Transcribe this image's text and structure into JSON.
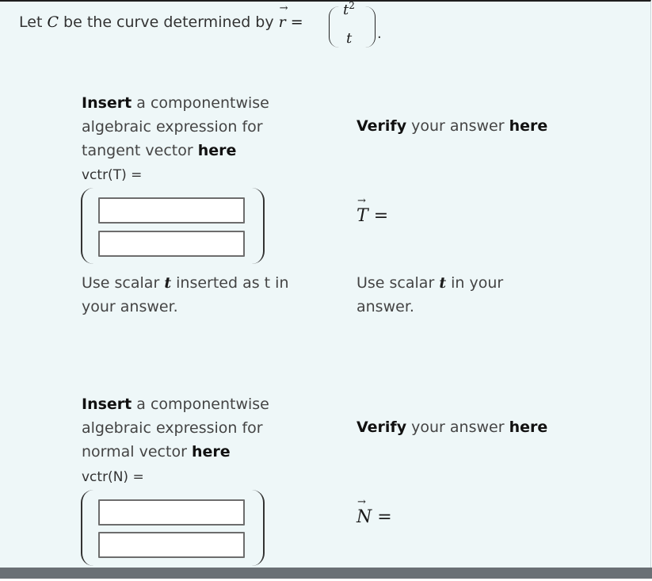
{
  "intro": {
    "prefix": "Let",
    "curve": "C",
    "middle": "be the curve determined by",
    "vec_r": "r",
    "equals": "=",
    "component1": "t",
    "component1_sup": "2",
    "component2": "t",
    "period": "."
  },
  "tangent": {
    "instr_bold1": "Insert",
    "instr_text1": "a componentwise algebraic expression for tangent vector",
    "instr_bold2": "here",
    "vector_label": "vctr(T) =",
    "input1_value": "",
    "input2_value": "",
    "note_prefix": "Use scalar",
    "note_var": "t",
    "note_suffix": "inserted as t in your answer.",
    "verify_bold1": "Verify",
    "verify_text": "your answer",
    "verify_bold2": "here",
    "result_symbol": "T",
    "result_equals": "=",
    "note2_prefix": "Use scalar",
    "note2_var": "t",
    "note2_suffix": "in your answer."
  },
  "normal": {
    "instr_bold1": "Insert",
    "instr_text1": "a componentwise algebraic expression for normal vector",
    "instr_bold2": "here",
    "vector_label": "vctr(N) =",
    "input1_value": "",
    "input2_value": "",
    "verify_bold1": "Verify",
    "verify_text": "your answer",
    "verify_bold2": "here",
    "result_symbol": "N",
    "result_equals": "="
  }
}
